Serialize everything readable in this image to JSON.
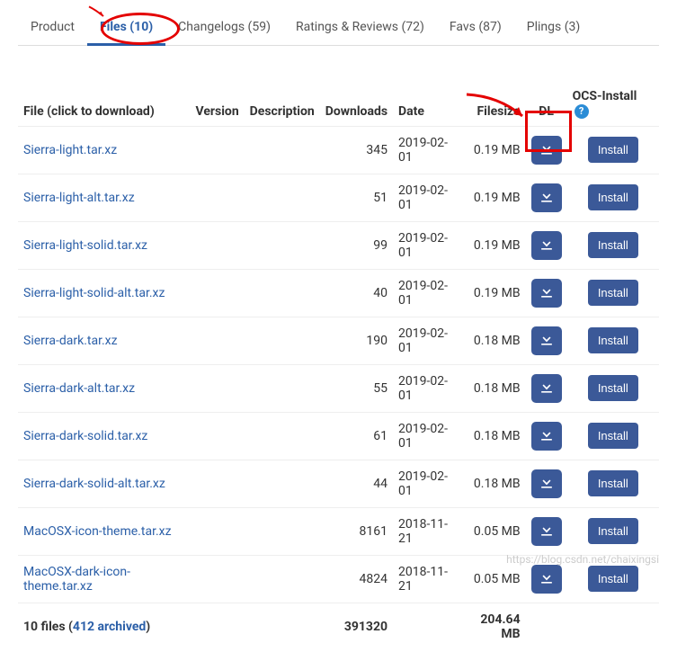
{
  "tabs": [
    {
      "label": "Product"
    },
    {
      "label": "Files (10)"
    },
    {
      "label": "Changelogs (59)"
    },
    {
      "label": "Ratings & Reviews (72)"
    },
    {
      "label": "Favs (87)"
    },
    {
      "label": "Plings (3)"
    }
  ],
  "headers": {
    "file": "File (click to download)",
    "version": "Version",
    "description": "Description",
    "downloads": "Downloads",
    "date": "Date",
    "filesize": "Filesize",
    "dl": "DL",
    "ocs": "OCS-Install"
  },
  "files": [
    {
      "name": "Sierra-light.tar.xz",
      "downloads": "345",
      "date": "2019-02-01",
      "size": "0.19 MB"
    },
    {
      "name": "Sierra-light-alt.tar.xz",
      "downloads": "51",
      "date": "2019-02-01",
      "size": "0.19 MB"
    },
    {
      "name": "Sierra-light-solid.tar.xz",
      "downloads": "99",
      "date": "2019-02-01",
      "size": "0.19 MB"
    },
    {
      "name": "Sierra-light-solid-alt.tar.xz",
      "downloads": "40",
      "date": "2019-02-01",
      "size": "0.19 MB"
    },
    {
      "name": "Sierra-dark.tar.xz",
      "downloads": "190",
      "date": "2019-02-01",
      "size": "0.18 MB"
    },
    {
      "name": "Sierra-dark-alt.tar.xz",
      "downloads": "55",
      "date": "2019-02-01",
      "size": "0.18 MB"
    },
    {
      "name": "Sierra-dark-solid.tar.xz",
      "downloads": "61",
      "date": "2019-02-01",
      "size": "0.18 MB"
    },
    {
      "name": "Sierra-dark-solid-alt.tar.xz",
      "downloads": "44",
      "date": "2019-02-01",
      "size": "0.18 MB"
    },
    {
      "name": "MacOSX-icon-theme.tar.xz",
      "downloads": "8161",
      "date": "2018-11-21",
      "size": "0.05 MB"
    },
    {
      "name": "MacOSX-dark-icon-theme.tar.xz",
      "downloads": "4824",
      "date": "2018-11-21",
      "size": "0.05 MB"
    }
  ],
  "install_label": "Install",
  "totals": {
    "files_text": "10 files (",
    "archived_text": "412 archived",
    "files_close": ")",
    "downloads": "391320",
    "size": "204.64 MB"
  },
  "help_glyph": "?",
  "watermark": "https://blog.csdn.net/chaixingsi"
}
